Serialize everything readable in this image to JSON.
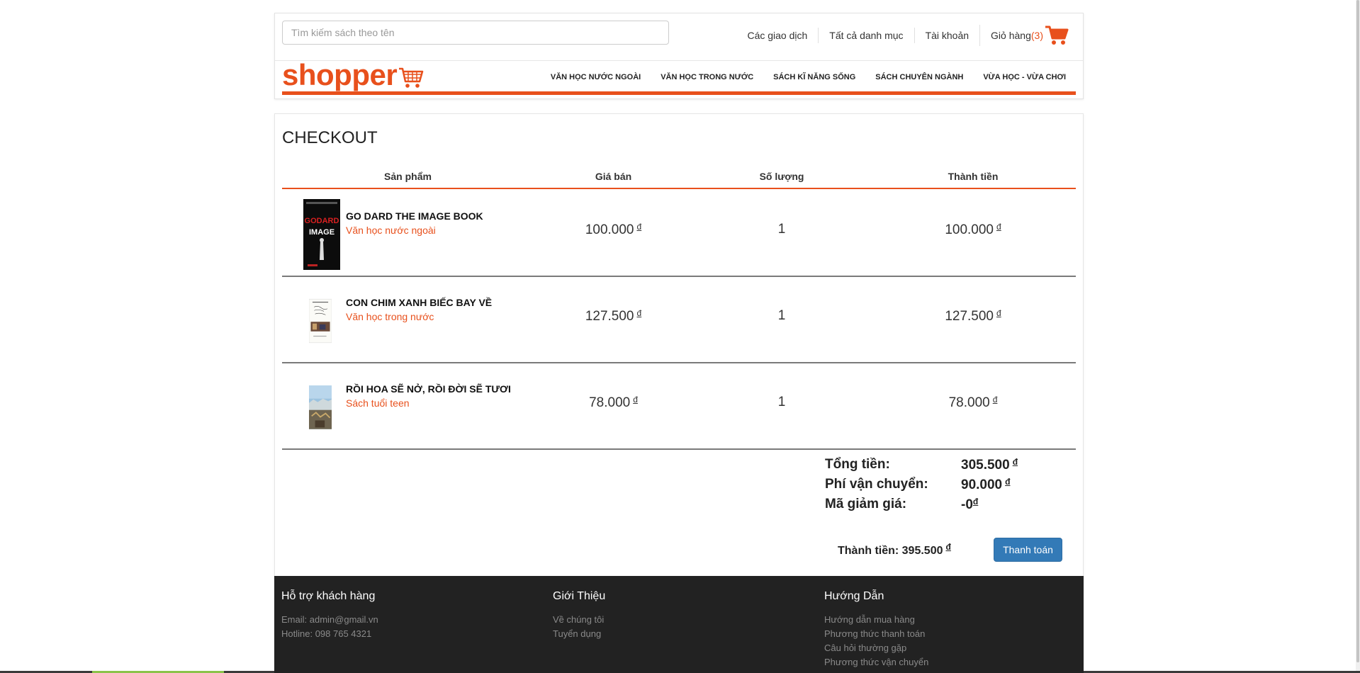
{
  "search": {
    "placeholder": "Tìm kiếm sách theo tên"
  },
  "top_links": {
    "transactions": "Các giao dịch",
    "categories": "Tất cả danh mục",
    "account": "Tài khoản",
    "cart_label": "Giỏ hàng",
    "cart_count": "(3)"
  },
  "logo": {
    "text": "shopper"
  },
  "nav": [
    "VĂN HỌC NƯỚC NGOÀI",
    "VĂN HỌC TRONG NƯỚC",
    "SÁCH KĨ NĂNG SỐNG",
    "SÁCH CHUYÊN NGÀNH",
    "VỪA HỌC - VỪA CHƠI"
  ],
  "checkout": {
    "title": "CHECKOUT",
    "headers": {
      "product": "Sản phẩm",
      "price": "Giá bán",
      "qty": "Số lượng",
      "total": "Thành tiền"
    },
    "currency": "đ",
    "items": [
      {
        "name": "GO DARD THE IMAGE BOOK",
        "category": "Văn học nước ngoài",
        "price": "100.000",
        "qty": "1",
        "total": "100.000"
      },
      {
        "name": "CON CHIM XANH BIẾC BAY VỀ",
        "category": "Văn học trong nước",
        "price": "127.500",
        "qty": "1",
        "total": "127.500"
      },
      {
        "name": "RỒI HOA SẼ NỞ, RỒI ĐỜI SẼ TƯƠI",
        "category": "Sách tuổi teen",
        "price": "78.000",
        "qty": "1",
        "total": "78.000"
      }
    ],
    "summary": {
      "subtotal_label": "Tổng tiền:",
      "subtotal": "305.500",
      "shipping_label": "Phí vận chuyển:",
      "shipping": "90.000",
      "discount_label": "Mã giảm giá:",
      "discount": "-0"
    },
    "grand_total_label": "Thành tiền: 395.500",
    "pay_button": "Thanh toán"
  },
  "footer": {
    "support": {
      "title": "Hỗ trợ khách hàng",
      "items": [
        "Email: admin@gmail.vn",
        "Hotline: 098 765 4321"
      ]
    },
    "about": {
      "title": "Giới Thiệu",
      "items": [
        "Về chúng tôi",
        "Tuyển dụng"
      ]
    },
    "guide": {
      "title": "Hướng Dẫn",
      "items": [
        "Hướng dẫn mua hàng",
        "Phương thức thanh toán",
        "Câu hỏi thường gặp",
        "Phương thức vận chuyển"
      ]
    }
  },
  "colors": {
    "accent": "#e8501c",
    "button": "#337ab7",
    "footer_bg": "#222222"
  }
}
